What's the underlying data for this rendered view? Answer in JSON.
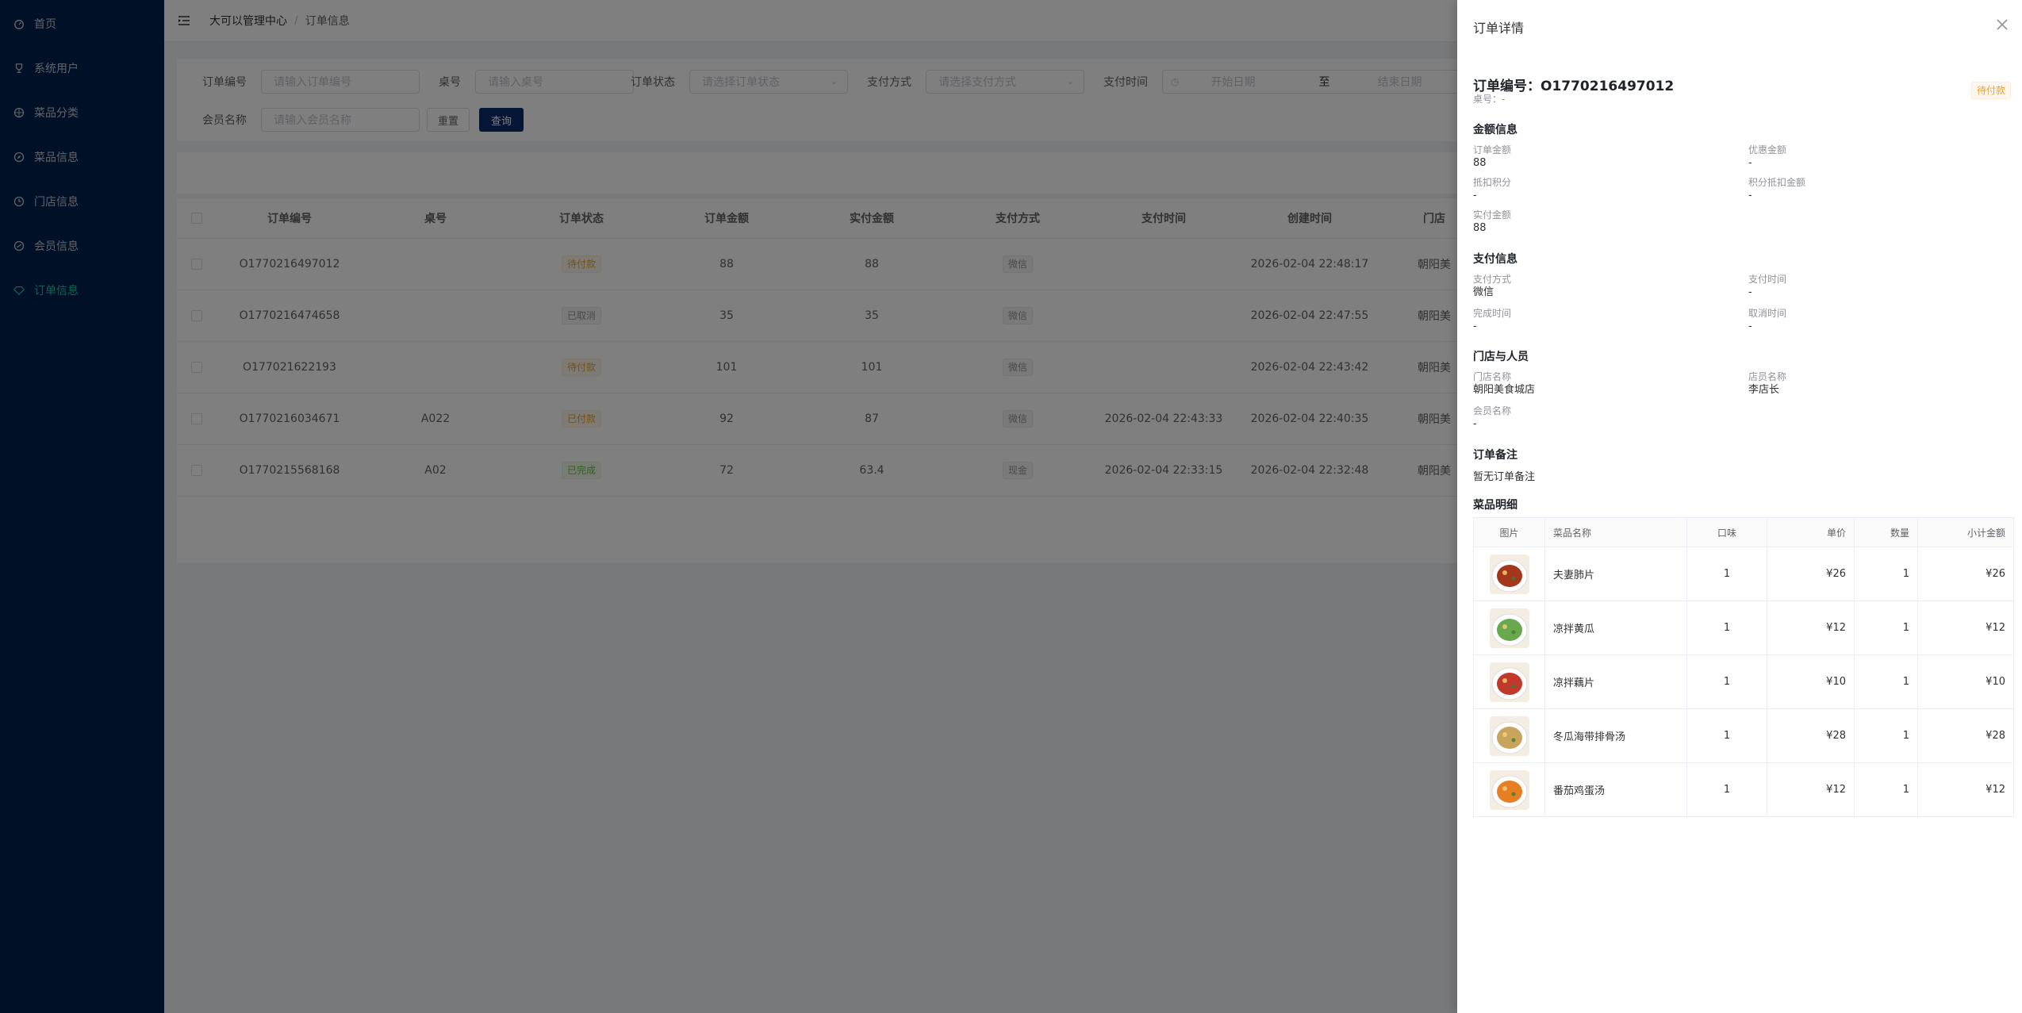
{
  "sidebar": {
    "items": [
      {
        "label": "首页",
        "icon": "dashboard-icon"
      },
      {
        "label": "系统用户",
        "icon": "trophy-icon"
      },
      {
        "label": "菜品分类",
        "icon": "basketball-icon"
      },
      {
        "label": "菜品信息",
        "icon": "compass-icon"
      },
      {
        "label": "门店信息",
        "icon": "clock-icon"
      },
      {
        "label": "会员信息",
        "icon": "link-icon"
      },
      {
        "label": "订单信息",
        "icon": "diamond-icon"
      }
    ],
    "active_index": 6,
    "colors": {
      "bg": "#00214d",
      "active": "#1fc2a7"
    }
  },
  "header": {
    "breadcrumb": [
      "大可以管理中心",
      "订单信息"
    ]
  },
  "search": {
    "order_no": {
      "label": "订单编号",
      "placeholder": "请输入订单编号"
    },
    "table_no": {
      "label": "桌号",
      "placeholder": "请输入桌号"
    },
    "status": {
      "label": "订单状态",
      "placeholder": "请选择订单状态"
    },
    "pay_method": {
      "label": "支付方式",
      "placeholder": "请选择支付方式"
    },
    "pay_time": {
      "label": "支付时间",
      "start_placeholder": "开始日期",
      "separator": "至",
      "end_placeholder": "结束日期"
    },
    "member": {
      "label": "会员名称",
      "placeholder": "请输入会员名称"
    },
    "reset_label": "重置",
    "query_label": "查询"
  },
  "table": {
    "columns": [
      "订单编号",
      "桌号",
      "订单状态",
      "订单金额",
      "实付金额",
      "支付方式",
      "支付时间",
      "创建时间",
      "门店"
    ],
    "rows": [
      {
        "order_no": "O1770216497012",
        "table_no": "",
        "status": "待付款",
        "status_type": "warn",
        "amount": "88",
        "paid": "88",
        "pay_method": "微信",
        "pay_time": "",
        "created": "2026-02-04 22:48:17",
        "store": "朝阳美"
      },
      {
        "order_no": "O1770216474658",
        "table_no": "",
        "status": "已取消",
        "status_type": "info",
        "amount": "35",
        "paid": "35",
        "pay_method": "微信",
        "pay_time": "",
        "created": "2026-02-04 22:47:55",
        "store": "朝阳美"
      },
      {
        "order_no": "O177021622193",
        "table_no": "",
        "status": "待付款",
        "status_type": "warn",
        "amount": "101",
        "paid": "101",
        "pay_method": "微信",
        "pay_time": "",
        "created": "2026-02-04 22:43:42",
        "store": "朝阳美"
      },
      {
        "order_no": "O1770216034671",
        "table_no": "A022",
        "status": "已付款",
        "status_type": "warn",
        "amount": "92",
        "paid": "87",
        "pay_method": "微信",
        "pay_time": "2026-02-04 22:43:33",
        "created": "2026-02-04 22:40:35",
        "store": "朝阳美"
      },
      {
        "order_no": "O1770215568168",
        "table_no": "A02",
        "status": "已完成",
        "status_type": "success",
        "amount": "72",
        "paid": "63.4",
        "pay_method": "现金",
        "pay_time": "2026-02-04 22:33:15",
        "created": "2026-02-04 22:32:48",
        "store": "朝阳美"
      }
    ]
  },
  "drawer": {
    "title": "订单详情",
    "order_no": "订单编号：O1770216497012",
    "table_no": "桌号：-",
    "status": "待付款",
    "amount_section": {
      "title": "金额信息",
      "fields": [
        {
          "label": "订单金额",
          "value": "88"
        },
        {
          "label": "优惠金额",
          "value": "-"
        },
        {
          "label": "抵扣积分",
          "value": "-"
        },
        {
          "label": "积分抵扣金额",
          "value": "-"
        },
        {
          "label": "实付金额",
          "value": "88"
        }
      ]
    },
    "pay_section": {
      "title": "支付信息",
      "fields": [
        {
          "label": "支付方式",
          "value": "微信"
        },
        {
          "label": "支付时间",
          "value": "-"
        },
        {
          "label": "完成时间",
          "value": "-"
        },
        {
          "label": "取消时间",
          "value": "-"
        }
      ]
    },
    "store_section": {
      "title": "门店与人员",
      "fields": [
        {
          "label": "门店名称",
          "value": "朝阳美食城店"
        },
        {
          "label": "店员名称",
          "value": "李店长"
        },
        {
          "label": "会员名称",
          "value": "-"
        }
      ]
    },
    "remark_section": {
      "title": "订单备注",
      "text": "暂无订单备注"
    },
    "items_section": {
      "title": "菜品明细",
      "columns": [
        "图片",
        "菜品名称",
        "口味",
        "单价",
        "数量",
        "小计金额"
      ],
      "rows": [
        {
          "name": "夫妻肺片",
          "taste": "1",
          "price": "¥26",
          "qty": "1",
          "subtotal": "¥26",
          "img_color": "#a3361b"
        },
        {
          "name": "凉拌黄瓜",
          "taste": "1",
          "price": "¥12",
          "qty": "1",
          "subtotal": "¥12",
          "img_color": "#6aa84f"
        },
        {
          "name": "凉拌藕片",
          "taste": "1",
          "price": "¥10",
          "qty": "1",
          "subtotal": "¥10",
          "img_color": "#c0392b"
        },
        {
          "name": "冬瓜海带排骨汤",
          "taste": "1",
          "price": "¥28",
          "qty": "1",
          "subtotal": "¥28",
          "img_color": "#c9a45c"
        },
        {
          "name": "番茄鸡蛋汤",
          "taste": "1",
          "price": "¥12",
          "qty": "1",
          "subtotal": "¥12",
          "img_color": "#e67e22"
        }
      ]
    }
  }
}
